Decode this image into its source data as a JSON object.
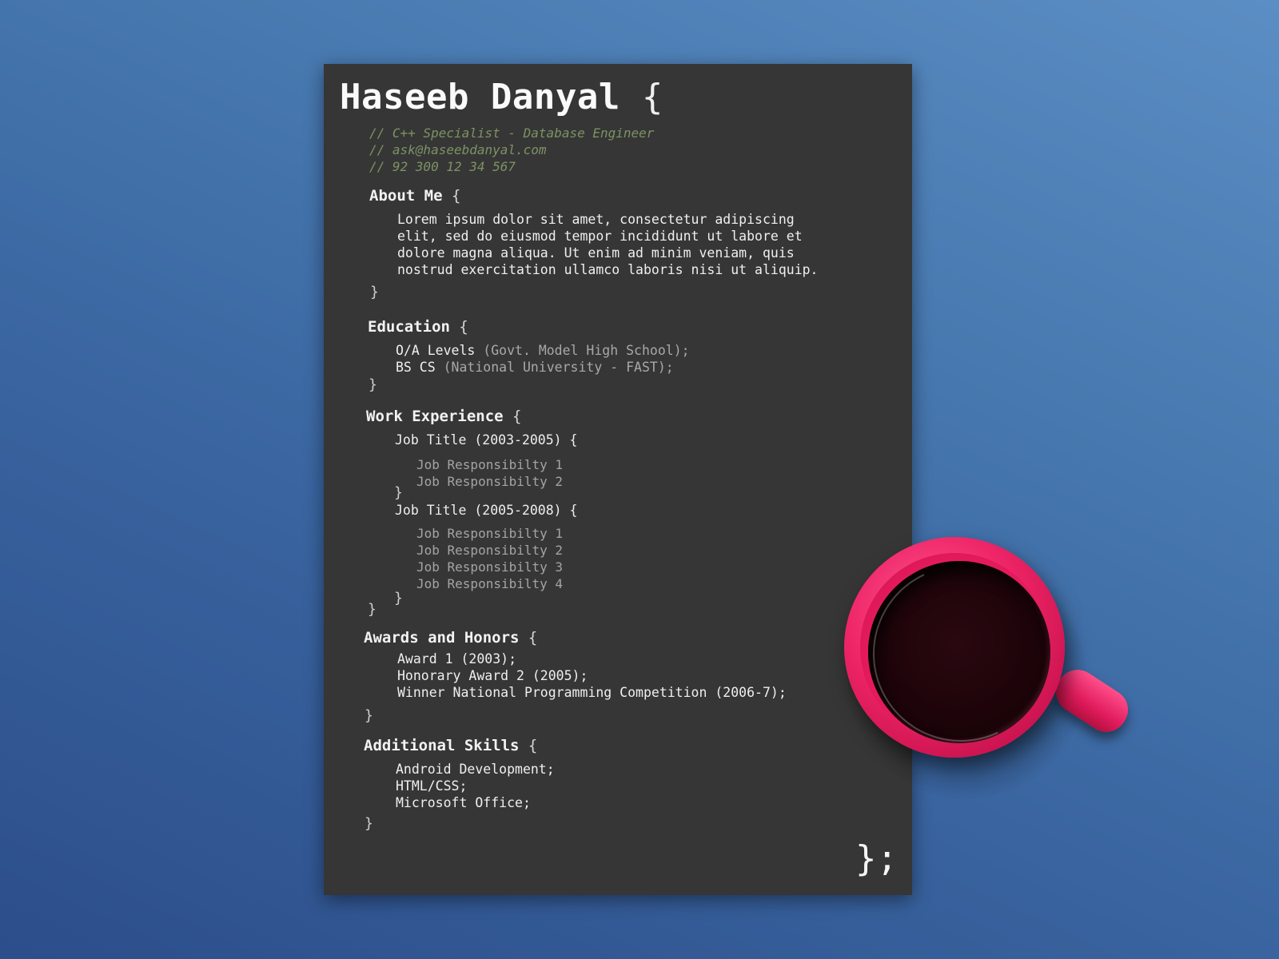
{
  "resume": {
    "name": "Haseeb Danyal",
    "open_brace": "{",
    "comments": [
      "// C++ Specialist - Database Engineer",
      "// ask@haseebdanyal.com",
      "// 92 300 12 34 567"
    ],
    "about": {
      "title": "About Me",
      "brace": "{",
      "lines": [
        "Lorem ipsum dolor sit amet, consectetur adipiscing",
        "elit, sed do eiusmod tempor incididunt ut labore et",
        "dolore magna aliqua. Ut enim ad minim veniam, quis",
        "nostrud exercitation ullamco laboris nisi ut aliquip."
      ],
      "close": "}"
    },
    "education": {
      "title": "Education",
      "brace": "{",
      "items": [
        {
          "degree": "O/A Levels",
          "school": " (Govt. Model High School);"
        },
        {
          "degree": "BS CS",
          "school": " (National University - FAST);"
        }
      ],
      "close": "}"
    },
    "work": {
      "title": "Work Experience",
      "brace": "{",
      "jobs": [
        {
          "title": "Job Title (2003-2005) {",
          "responsibilities": [
            "Job Responsibilty 1",
            "Job Responsibilty 2"
          ],
          "close": "}"
        },
        {
          "title": "Job Title (2005-2008) {",
          "responsibilities": [
            "Job Responsibilty 1",
            "Job Responsibilty 2",
            "Job Responsibilty 3",
            "Job Responsibilty 4"
          ],
          "close": "}"
        }
      ],
      "close": "}"
    },
    "awards": {
      "title": "Awards and Honors",
      "brace": "{",
      "items": [
        "Award 1 (2003);",
        "Honorary Award 2 (2005);",
        "Winner National Programming Competition (2006-7);"
      ],
      "close": "}"
    },
    "skills": {
      "title": "Additional Skills",
      "brace": "{",
      "items": [
        "Android Development;",
        "HTML/CSS;",
        "Microsoft Office;"
      ],
      "close": "}"
    },
    "final_close": "};"
  },
  "colors": {
    "background": "#4677ae",
    "paper": "#363636",
    "comment": "#7d9263",
    "mug": "#ee2467"
  }
}
